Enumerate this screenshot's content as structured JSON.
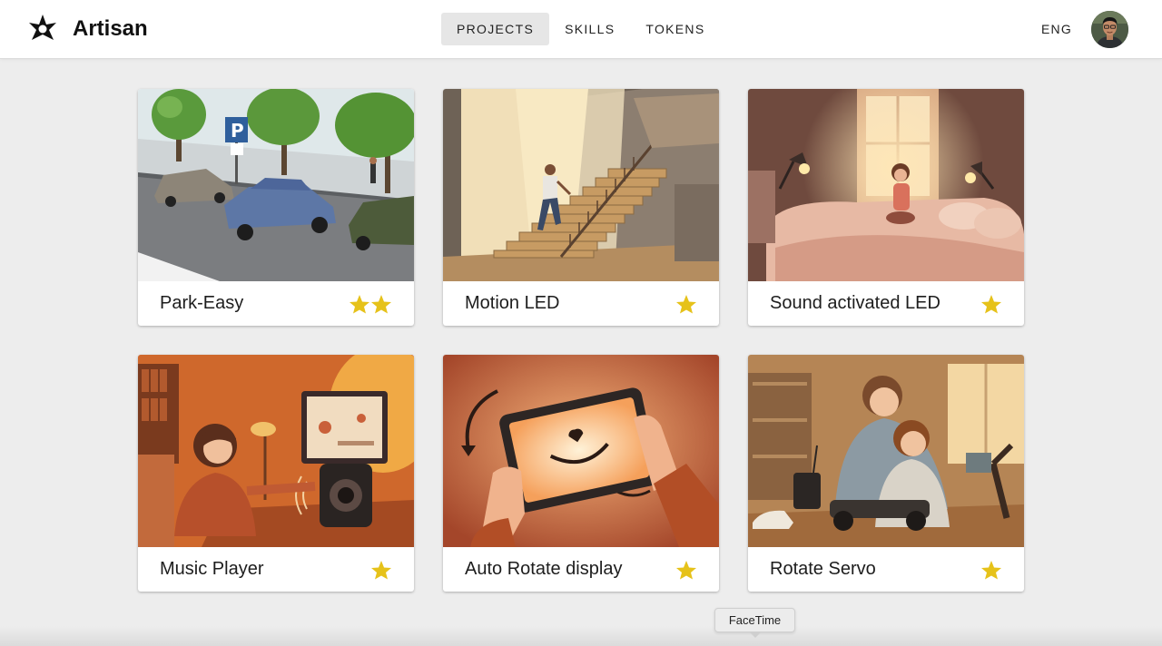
{
  "header": {
    "brand_name": "Artisan",
    "logo_icon": "star-burst-icon",
    "nav": [
      {
        "label": "PROJECTS",
        "active": true
      },
      {
        "label": "SKILLS",
        "active": false
      },
      {
        "label": "TOKENS",
        "active": false
      }
    ],
    "language": "ENG",
    "avatar_icon": "user-avatar"
  },
  "projects": [
    {
      "title": "Park-Easy",
      "stars": 2,
      "illustration": "parking-street-scene"
    },
    {
      "title": "Motion LED",
      "stars": 1,
      "illustration": "person-climbing-lit-stairs"
    },
    {
      "title": "Sound activated LED",
      "stars": 1,
      "illustration": "girl-clapping-bedroom-lamps"
    },
    {
      "title": "Music Player",
      "stars": 1,
      "illustration": "girl-at-desk-with-speaker"
    },
    {
      "title": "Auto Rotate display",
      "stars": 1,
      "illustration": "hands-rotating-tablet"
    },
    {
      "title": "Rotate Servo",
      "stars": 1,
      "illustration": "father-son-building-rc-car"
    }
  ],
  "colors": {
    "star": "#e6c21a",
    "nav_active_bg": "#e6e6e6",
    "page_bg": "#ededed"
  },
  "tooltip": {
    "label": "FaceTime"
  }
}
